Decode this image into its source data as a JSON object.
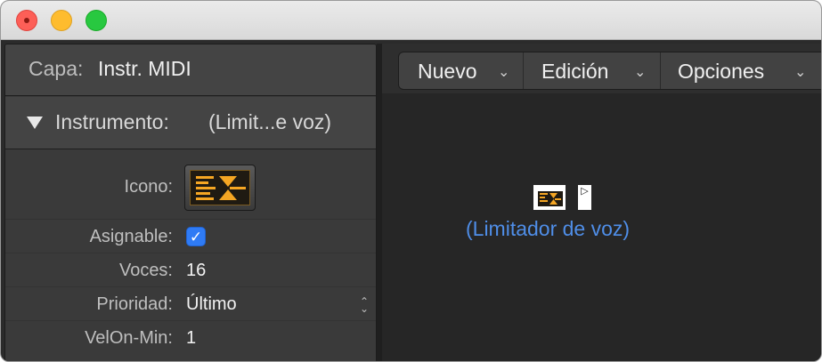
{
  "window": {
    "traffic_lights": {
      "close": "close-icon",
      "minimize": "minimize-icon",
      "zoom": "zoom-icon"
    }
  },
  "inspector": {
    "layer_label": "Capa:",
    "layer_value": "Instr. MIDI",
    "section_title": "Instrumento:",
    "section_value": "(Limit...e voz)",
    "params": {
      "icon_label": "Icono:",
      "assignable_label": "Asignable:",
      "assignable_checked": true,
      "voices_label": "Voces:",
      "voices_value": "16",
      "priority_label": "Prioridad:",
      "priority_value": "Último",
      "velon_label": "VelOn-Min:",
      "velon_value": "1"
    }
  },
  "toolbar": {
    "new_label": "Nuevo",
    "edit_label": "Edición",
    "options_label": "Opciones"
  },
  "canvas": {
    "object_label": "(Limitador de voz)"
  },
  "colors": {
    "accent_blue": "#2f7bf5",
    "object_label": "#4f8ee8",
    "icon_orange": "#f5a623"
  }
}
